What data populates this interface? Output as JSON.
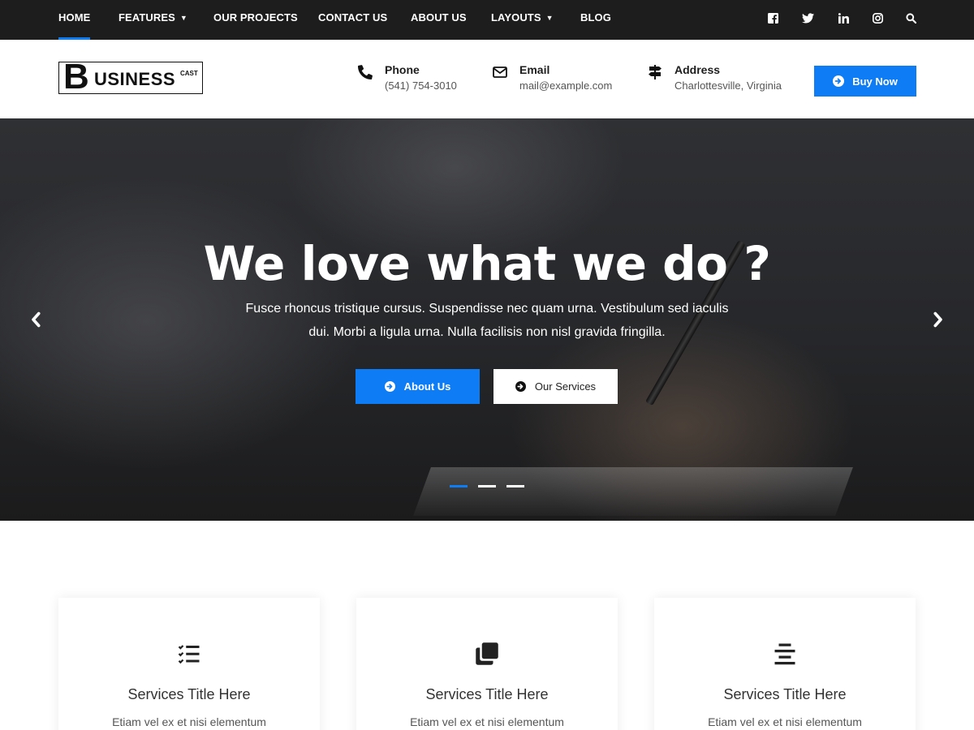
{
  "nav": {
    "items": [
      {
        "label": "HOME",
        "active": true,
        "dropdown": false
      },
      {
        "label": "FEATURES",
        "active": false,
        "dropdown": true
      },
      {
        "label": "OUR PROJECTS",
        "active": false,
        "dropdown": false
      },
      {
        "label": "CONTACT US",
        "active": false,
        "dropdown": false
      },
      {
        "label": "ABOUT US",
        "active": false,
        "dropdown": false
      },
      {
        "label": "LAYOUTS",
        "active": false,
        "dropdown": true
      },
      {
        "label": "BLOG",
        "active": false,
        "dropdown": false
      }
    ],
    "social_icons": [
      "facebook-icon",
      "twitter-icon",
      "linkedin-icon",
      "instagram-icon",
      "search-icon"
    ]
  },
  "header": {
    "logo": {
      "letter": "B",
      "word": "USINESS",
      "tag": "CAST"
    },
    "contacts": [
      {
        "icon": "phone-icon",
        "title": "Phone",
        "value": "(541) 754-3010"
      },
      {
        "icon": "envelope-icon",
        "title": "Email",
        "value": "mail@example.com"
      },
      {
        "icon": "signpost-icon",
        "title": "Address",
        "value": "Charlottesville, Virginia"
      }
    ],
    "buy_label": "Buy Now"
  },
  "hero": {
    "title": "We love what we do ?",
    "text": "Fusce rhoncus tristique cursus. Suspendisse nec quam urna. Vestibulum sed iaculis dui. Morbi a ligula urna. Nulla facilisis non nisl gravida fringilla.",
    "about_label": "About Us",
    "services_label": "Our Services",
    "slides": 3,
    "active_slide": 1
  },
  "services": [
    {
      "icon": "checklist-icon",
      "title": "Services Title Here",
      "text": "Etiam vel ex et nisi elementum"
    },
    {
      "icon": "copy-icon",
      "title": "Services Title Here",
      "text": "Etiam vel ex et nisi elementum"
    },
    {
      "icon": "align-center-icon",
      "title": "Services Title Here",
      "text": "Etiam vel ex et nisi elementum"
    }
  ],
  "colors": {
    "accent": "#0e7cf5",
    "nav_bg": "#1d1d1d"
  }
}
